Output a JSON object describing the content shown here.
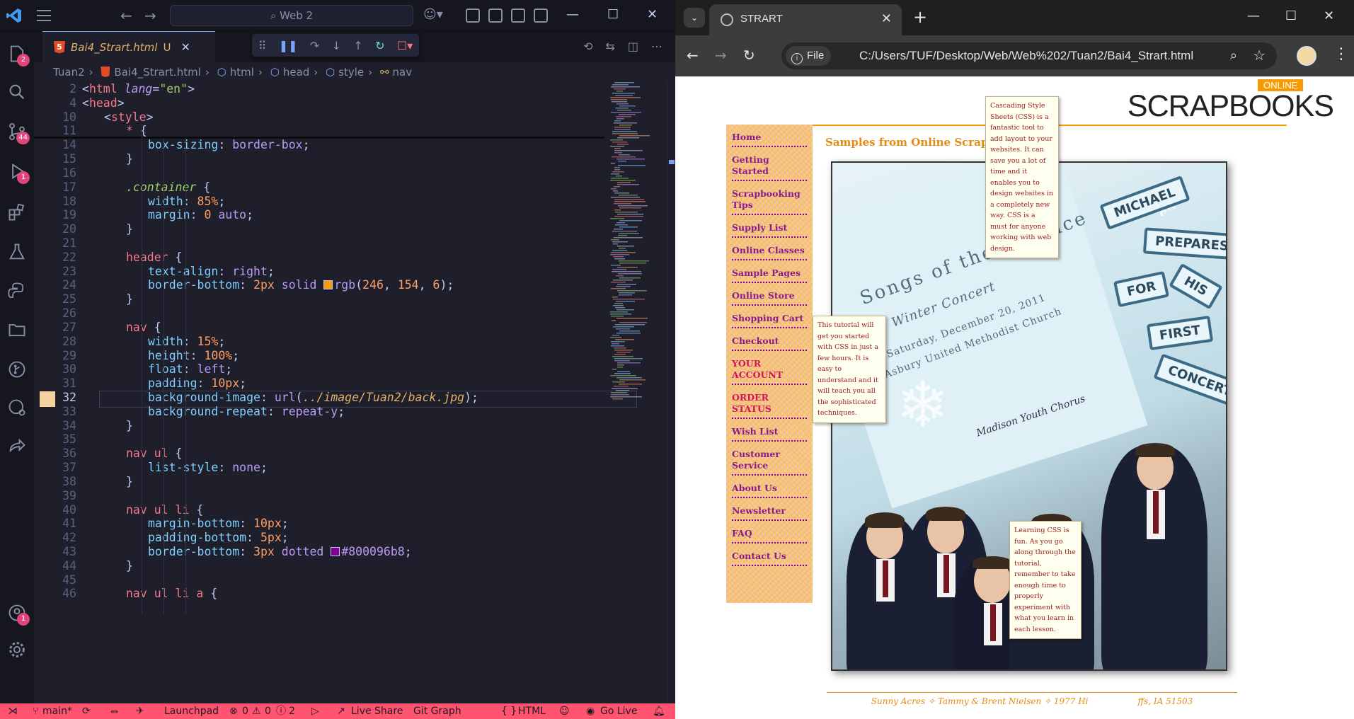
{
  "vscode": {
    "search_text": "Web 2",
    "tab": {
      "name": "Bai4_Strart.html",
      "status": "U"
    },
    "breadcrumb": [
      "Tuan2",
      "Bai4_Strart.html",
      "html",
      "head",
      "style",
      "nav"
    ],
    "activity_badges": {
      "explorer": "2",
      "scm": "44",
      "debug": "1",
      "accounts": "1"
    },
    "lines": [
      {
        "no": "2",
        "segs": [
          [
            "punc",
            "<"
          ],
          [
            "t",
            "html"
          ],
          [
            "punc",
            " "
          ],
          [
            "a",
            "lang"
          ],
          [
            "punc",
            "="
          ],
          [
            "s",
            "\"en\""
          ],
          [
            "punc",
            ">"
          ]
        ],
        "indent": 0
      },
      {
        "no": "4",
        "segs": [
          [
            "punc",
            "<"
          ],
          [
            "t",
            "head"
          ],
          [
            "punc",
            ">"
          ]
        ],
        "indent": 0
      },
      {
        "no": "10",
        "segs": [
          [
            "punc",
            "<"
          ],
          [
            "t",
            "style"
          ],
          [
            "punc",
            ">"
          ]
        ],
        "indent": 1
      },
      {
        "no": "11",
        "segs": [
          [
            "sel",
            "* "
          ],
          [
            "punc",
            "{"
          ]
        ],
        "indent": 2
      },
      {
        "no": "14",
        "segs": [
          [
            "p",
            "box-sizing"
          ],
          [
            "punc",
            ": "
          ],
          [
            "v",
            "border-box"
          ],
          [
            "punc",
            ";"
          ]
        ],
        "indent": 3
      },
      {
        "no": "15",
        "segs": [
          [
            "punc",
            "}"
          ]
        ],
        "indent": 2
      },
      {
        "no": "16",
        "segs": [],
        "indent": 0
      },
      {
        "no": "17",
        "segs": [
          [
            "cls",
            ".container"
          ],
          [
            "punc",
            " {"
          ]
        ],
        "indent": 2
      },
      {
        "no": "18",
        "segs": [
          [
            "p",
            "width"
          ],
          [
            "punc",
            ": "
          ],
          [
            "n",
            "85%"
          ],
          [
            "punc",
            ";"
          ]
        ],
        "indent": 3
      },
      {
        "no": "19",
        "segs": [
          [
            "p",
            "margin"
          ],
          [
            "punc",
            ": "
          ],
          [
            "n",
            "0"
          ],
          [
            "punc",
            " "
          ],
          [
            "v",
            "auto"
          ],
          [
            "punc",
            ";"
          ]
        ],
        "indent": 3
      },
      {
        "no": "20",
        "segs": [
          [
            "punc",
            "}"
          ]
        ],
        "indent": 2
      },
      {
        "no": "21",
        "segs": [],
        "indent": 0
      },
      {
        "no": "22",
        "segs": [
          [
            "sel",
            "header"
          ],
          [
            "punc",
            " {"
          ]
        ],
        "indent": 2
      },
      {
        "no": "23",
        "segs": [
          [
            "p",
            "text-align"
          ],
          [
            "punc",
            ": "
          ],
          [
            "v",
            "right"
          ],
          [
            "punc",
            ";"
          ]
        ],
        "indent": 3
      },
      {
        "no": "24",
        "segs": [
          [
            "p",
            "border-bottom"
          ],
          [
            "punc",
            ": "
          ],
          [
            "n",
            "2px"
          ],
          [
            "punc",
            " "
          ],
          [
            "v",
            "solid"
          ],
          [
            "punc",
            " "
          ],
          [
            "swatch",
            "rgb(246,154,6)"
          ],
          [
            "v",
            "rgb"
          ],
          [
            "punc",
            "("
          ],
          [
            "n",
            "246"
          ],
          [
            "punc",
            ", "
          ],
          [
            "n",
            "154"
          ],
          [
            "punc",
            ", "
          ],
          [
            "n",
            "6"
          ],
          [
            "punc",
            ");"
          ]
        ],
        "indent": 3
      },
      {
        "no": "25",
        "segs": [
          [
            "punc",
            "}"
          ]
        ],
        "indent": 2
      },
      {
        "no": "26",
        "segs": [],
        "indent": 0
      },
      {
        "no": "27",
        "segs": [
          [
            "sel",
            "nav"
          ],
          [
            "punc",
            " {"
          ]
        ],
        "indent": 2
      },
      {
        "no": "28",
        "segs": [
          [
            "p",
            "width"
          ],
          [
            "punc",
            ": "
          ],
          [
            "n",
            "15%"
          ],
          [
            "punc",
            ";"
          ]
        ],
        "indent": 3
      },
      {
        "no": "29",
        "segs": [
          [
            "p",
            "height"
          ],
          [
            "punc",
            ": "
          ],
          [
            "n",
            "100%"
          ],
          [
            "punc",
            ";"
          ]
        ],
        "indent": 3
      },
      {
        "no": "30",
        "segs": [
          [
            "p",
            "float"
          ],
          [
            "punc",
            ": "
          ],
          [
            "v",
            "left"
          ],
          [
            "punc",
            ";"
          ]
        ],
        "indent": 3
      },
      {
        "no": "31",
        "segs": [
          [
            "p",
            "padding"
          ],
          [
            "punc",
            ": "
          ],
          [
            "n",
            "10px"
          ],
          [
            "punc",
            ";"
          ]
        ],
        "indent": 3
      },
      {
        "no": "32",
        "segs": [
          [
            "p",
            "background-image"
          ],
          [
            "punc",
            ": "
          ],
          [
            "v",
            "url"
          ],
          [
            "punc",
            "("
          ],
          [
            "u",
            "../image/Tuan2/back.jpg"
          ],
          [
            "punc",
            ");"
          ]
        ],
        "indent": 3,
        "current": true
      },
      {
        "no": "33",
        "segs": [
          [
            "p",
            "background-repeat"
          ],
          [
            "punc",
            ": "
          ],
          [
            "v",
            "repeat-y"
          ],
          [
            "punc",
            ";"
          ]
        ],
        "indent": 3
      },
      {
        "no": "34",
        "segs": [
          [
            "punc",
            "}"
          ]
        ],
        "indent": 2
      },
      {
        "no": "35",
        "segs": [],
        "indent": 0
      },
      {
        "no": "36",
        "segs": [
          [
            "sel",
            "nav ul"
          ],
          [
            "punc",
            " {"
          ]
        ],
        "indent": 2
      },
      {
        "no": "37",
        "segs": [
          [
            "p",
            "list-style"
          ],
          [
            "punc",
            ": "
          ],
          [
            "v",
            "none"
          ],
          [
            "punc",
            ";"
          ]
        ],
        "indent": 3
      },
      {
        "no": "38",
        "segs": [
          [
            "punc",
            "}"
          ]
        ],
        "indent": 2
      },
      {
        "no": "39",
        "segs": [],
        "indent": 0
      },
      {
        "no": "40",
        "segs": [
          [
            "sel",
            "nav ul li"
          ],
          [
            "punc",
            " {"
          ]
        ],
        "indent": 2
      },
      {
        "no": "41",
        "segs": [
          [
            "p",
            "margin-bottom"
          ],
          [
            "punc",
            ": "
          ],
          [
            "n",
            "10px"
          ],
          [
            "punc",
            ";"
          ]
        ],
        "indent": 3
      },
      {
        "no": "42",
        "segs": [
          [
            "p",
            "padding-bottom"
          ],
          [
            "punc",
            ": "
          ],
          [
            "n",
            "5px"
          ],
          [
            "punc",
            ";"
          ]
        ],
        "indent": 3
      },
      {
        "no": "43",
        "segs": [
          [
            "p",
            "border-bottom"
          ],
          [
            "punc",
            ": "
          ],
          [
            "n",
            "3px"
          ],
          [
            "punc",
            " "
          ],
          [
            "v",
            "dotted"
          ],
          [
            "punc",
            " "
          ],
          [
            "swatch",
            "#800096"
          ],
          [
            "v",
            "#800096b8"
          ],
          [
            "punc",
            ";"
          ]
        ],
        "indent": 3
      },
      {
        "no": "44",
        "segs": [
          [
            "punc",
            "}"
          ]
        ],
        "indent": 2
      },
      {
        "no": "45",
        "segs": [],
        "indent": 0
      },
      {
        "no": "46",
        "segs": [
          [
            "sel",
            "nav ul li a"
          ],
          [
            "punc",
            " {"
          ]
        ],
        "indent": 2
      }
    ],
    "status": {
      "branch": "main*",
      "launchpad": "Launchpad",
      "errors": "0",
      "warnings": "0",
      "info": "2",
      "live_share": "Live Share",
      "git_graph": "Git Graph",
      "language": "HTML",
      "go_live": "Go Live"
    }
  },
  "chrome": {
    "tab_title": "STRART",
    "chip_label": "File",
    "url": "C:/Users/TUF/Desktop/Web/Web%202/Tuan2/Bai4_Strart.html"
  },
  "page": {
    "badge": "ONLINE",
    "logo": "SCRAPBOOKS",
    "heading": "Samples from Online Scrapbooks",
    "nav": [
      {
        "label": "Home",
        "red": false
      },
      {
        "label": "Getting Started",
        "red": false
      },
      {
        "label": "Scrapbooking Tips",
        "red": false
      },
      {
        "label": "Supply List",
        "red": false
      },
      {
        "label": "Online Classes",
        "red": false
      },
      {
        "label": "Sample Pages",
        "red": false
      },
      {
        "label": "Online Store",
        "red": false
      },
      {
        "label": "Shopping Cart",
        "red": false
      },
      {
        "label": "Checkout",
        "red": false
      },
      {
        "label": "YOUR ACCOUNT",
        "red": true
      },
      {
        "label": "ORDER STATUS",
        "red": true
      },
      {
        "label": "Wish List",
        "red": false
      },
      {
        "label": "Customer Service",
        "red": false
      },
      {
        "label": "About Us",
        "red": false
      },
      {
        "label": "Newsletter",
        "red": false
      },
      {
        "label": "FAQ",
        "red": false
      },
      {
        "label": "Contact Us",
        "red": false
      }
    ],
    "photo": {
      "title": "Songs of the Solstice",
      "subtitle": "Winter Concert",
      "date": "Saturday, December 20, 2011",
      "venue": "Asbury United Methodist Church",
      "script": "Madison Youth Chorus",
      "words": [
        "MICHAEL",
        "PREPARES",
        "FOR",
        "HIS",
        "FIRST",
        "CONCERT"
      ]
    },
    "tooltips": {
      "top": "Cascading Style Sheets (CSS) is a fantastic tool to add layout to your websites. It can save you a lot of time and it enables you to design websites in a completely new way. CSS is a must for anyone working with web design.",
      "middle": "This tutorial will get you started with CSS in just a few hours. It is easy to understand and it will teach you all the sophisticated techniques.",
      "bottom": "Learning CSS is fun. As you go along through the tutorial, remember to take enough time to properly experiment with what you learn in each lesson."
    },
    "footer": "Sunny Acres ✧ Tammy & Brent Nielsen ✧ 1977 Hi",
    "footer_tail": "ffs, IA 51503"
  }
}
